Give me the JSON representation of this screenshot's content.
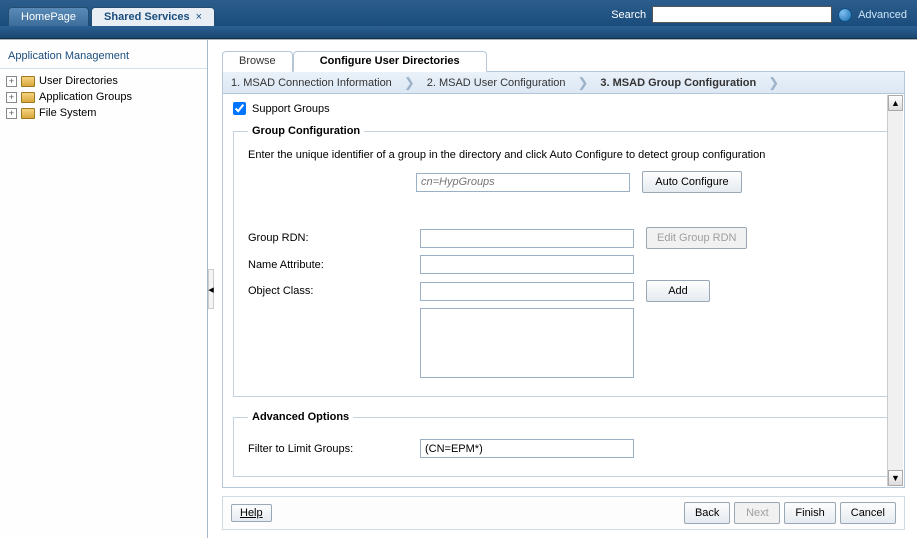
{
  "top": {
    "tabs": [
      {
        "label": "HomePage",
        "active": false,
        "closable": false
      },
      {
        "label": "Shared Services",
        "active": true,
        "closable": true
      }
    ],
    "search_label": "Search",
    "search_value": "",
    "advanced_label": "Advanced"
  },
  "sidebar": {
    "title": "Application Management",
    "items": [
      {
        "label": "User Directories"
      },
      {
        "label": "Application Groups"
      },
      {
        "label": "File System"
      }
    ]
  },
  "main": {
    "browse_tabs": {
      "inactive": "Browse",
      "active": "Configure User Directories"
    },
    "wizard": {
      "step1": "1. MSAD Connection Information",
      "step2": "2. MSAD User Configuration",
      "step3": "3. MSAD Group Configuration"
    },
    "support_groups_label": "Support Groups",
    "support_groups_checked": true,
    "group_config": {
      "legend": "Group Configuration",
      "help": "Enter the unique identifier of a group in the directory and click Auto Configure to detect group configuration",
      "unique_id_placeholder": "cn=HypGroups",
      "unique_id_value": "",
      "auto_configure_btn": "Auto Configure",
      "group_rdn_label": "Group RDN:",
      "group_rdn_value": "",
      "edit_group_rdn_btn": "Edit Group RDN",
      "name_attr_label": "Name Attribute:",
      "name_attr_value": "",
      "object_class_label": "Object Class:",
      "object_class_value": "",
      "add_btn": "Add"
    },
    "advanced": {
      "legend": "Advanced Options",
      "filter_label": "Filter to Limit Groups:",
      "filter_value": "(CN=EPM*)"
    }
  },
  "footer": {
    "help": "Help",
    "back": "Back",
    "next": "Next",
    "finish": "Finish",
    "cancel": "Cancel"
  }
}
